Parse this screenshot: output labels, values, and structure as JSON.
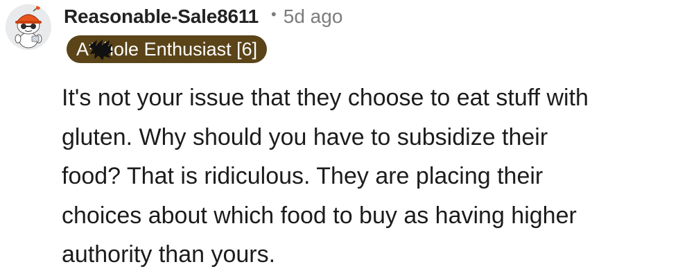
{
  "comment": {
    "author": "Reasonable-Sale8611",
    "separator": "•",
    "timestamp": "5d ago",
    "flair": "A**hole Enthusiast [6]",
    "body_lines": [
      "It's not your issue that they choose to eat stuff with",
      "gluten. Why should you have to subsidize their",
      "food? That is ridiculous. They are placing their",
      "choices about which food to buy as having higher",
      "authority than yours."
    ]
  },
  "colors": {
    "flair_background": "#5a4418",
    "flair_text": "#ffffff",
    "username": "#222222",
    "timestamp": "#7c7c7c",
    "body_text": "#1c1c1c"
  },
  "icons": {
    "avatar": "snoo-avatar-icon"
  }
}
